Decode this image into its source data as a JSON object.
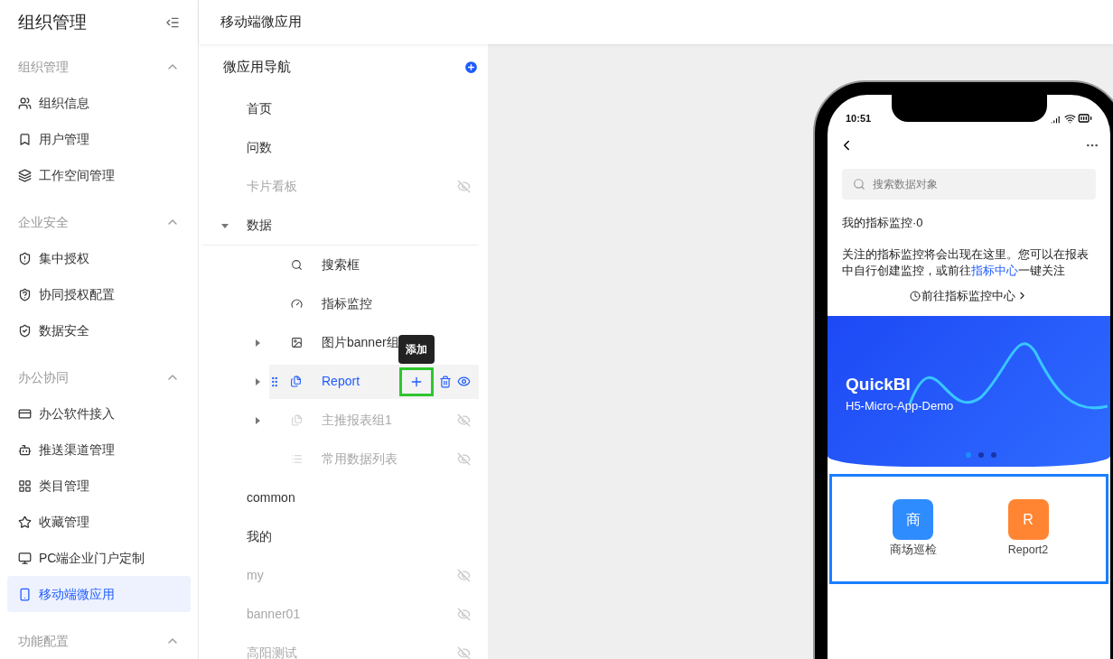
{
  "sidebar": {
    "title": "组织管理",
    "groups": [
      {
        "label": "组织管理",
        "expanded": true,
        "items": [
          {
            "label": "组织信息",
            "selected": false
          },
          {
            "label": "用户管理",
            "selected": false
          },
          {
            "label": "工作空间管理",
            "selected": false
          }
        ]
      },
      {
        "label": "企业安全",
        "expanded": true,
        "items": [
          {
            "label": "集中授权",
            "selected": false
          },
          {
            "label": "协同授权配置",
            "selected": false
          },
          {
            "label": "数据安全",
            "selected": false
          }
        ]
      },
      {
        "label": "办公协同",
        "expanded": true,
        "items": [
          {
            "label": "办公软件接入",
            "selected": false
          },
          {
            "label": "推送渠道管理",
            "selected": false
          },
          {
            "label": "类目管理",
            "selected": false
          },
          {
            "label": "收藏管理",
            "selected": false
          },
          {
            "label": "PC端企业门户定制",
            "selected": false
          },
          {
            "label": "移动端微应用",
            "selected": true
          }
        ]
      },
      {
        "label": "功能配置",
        "expanded": true
      }
    ]
  },
  "header": {
    "title": "移动端微应用"
  },
  "nav": {
    "title": "微应用导航",
    "tooltip": "添加",
    "items": [
      {
        "label": "首页",
        "hidden": false,
        "selected": false
      },
      {
        "label": "问数",
        "hidden": false,
        "selected": false
      },
      {
        "label": "卡片看板",
        "hidden": true,
        "selected": false
      },
      {
        "label": "数据",
        "hidden": false,
        "selected": false,
        "expanded": true,
        "children": [
          {
            "label": "搜索框",
            "hidden": false,
            "selected": false
          },
          {
            "label": "指标监控",
            "hidden": false,
            "selected": false
          },
          {
            "label": "图片banner组",
            "hidden": false,
            "selected": false,
            "expanded": false
          },
          {
            "label": "Report",
            "hidden": false,
            "selected": true,
            "expanded": false
          },
          {
            "label": "主推报表组1",
            "hidden": true,
            "selected": false,
            "expanded": false
          },
          {
            "label": "常用数据列表",
            "hidden": true,
            "selected": false
          }
        ]
      },
      {
        "label": "common",
        "hidden": false,
        "selected": false
      },
      {
        "label": "我的",
        "hidden": false,
        "selected": false
      },
      {
        "label": "my",
        "hidden": true,
        "selected": false
      },
      {
        "label": "banner01",
        "hidden": true,
        "selected": false
      },
      {
        "label": "高阳测试",
        "hidden": true,
        "selected": false
      }
    ]
  },
  "phone": {
    "time": "10:51",
    "search_placeholder": "搜索数据对象",
    "monitor_title": "我的指标监控·0",
    "description_before": "关注的指标监控将会出现在这里。您可以在报表中自行创建监控，或前往",
    "description_link": "指标中心",
    "description_after": "一键关注",
    "goto_button": "前往指标监控中心",
    "banner": {
      "title": "QuickBI",
      "subtitle": "H5-Micro-App-Demo",
      "dots": [
        {
          "selected": true
        },
        {
          "selected": false
        },
        {
          "selected": false
        }
      ]
    },
    "apps": [
      {
        "glyph": "商",
        "label": "商场巡检",
        "color": "#2f8cff"
      },
      {
        "glyph": "R",
        "label": "Report2",
        "color": "#ff8533"
      }
    ]
  }
}
